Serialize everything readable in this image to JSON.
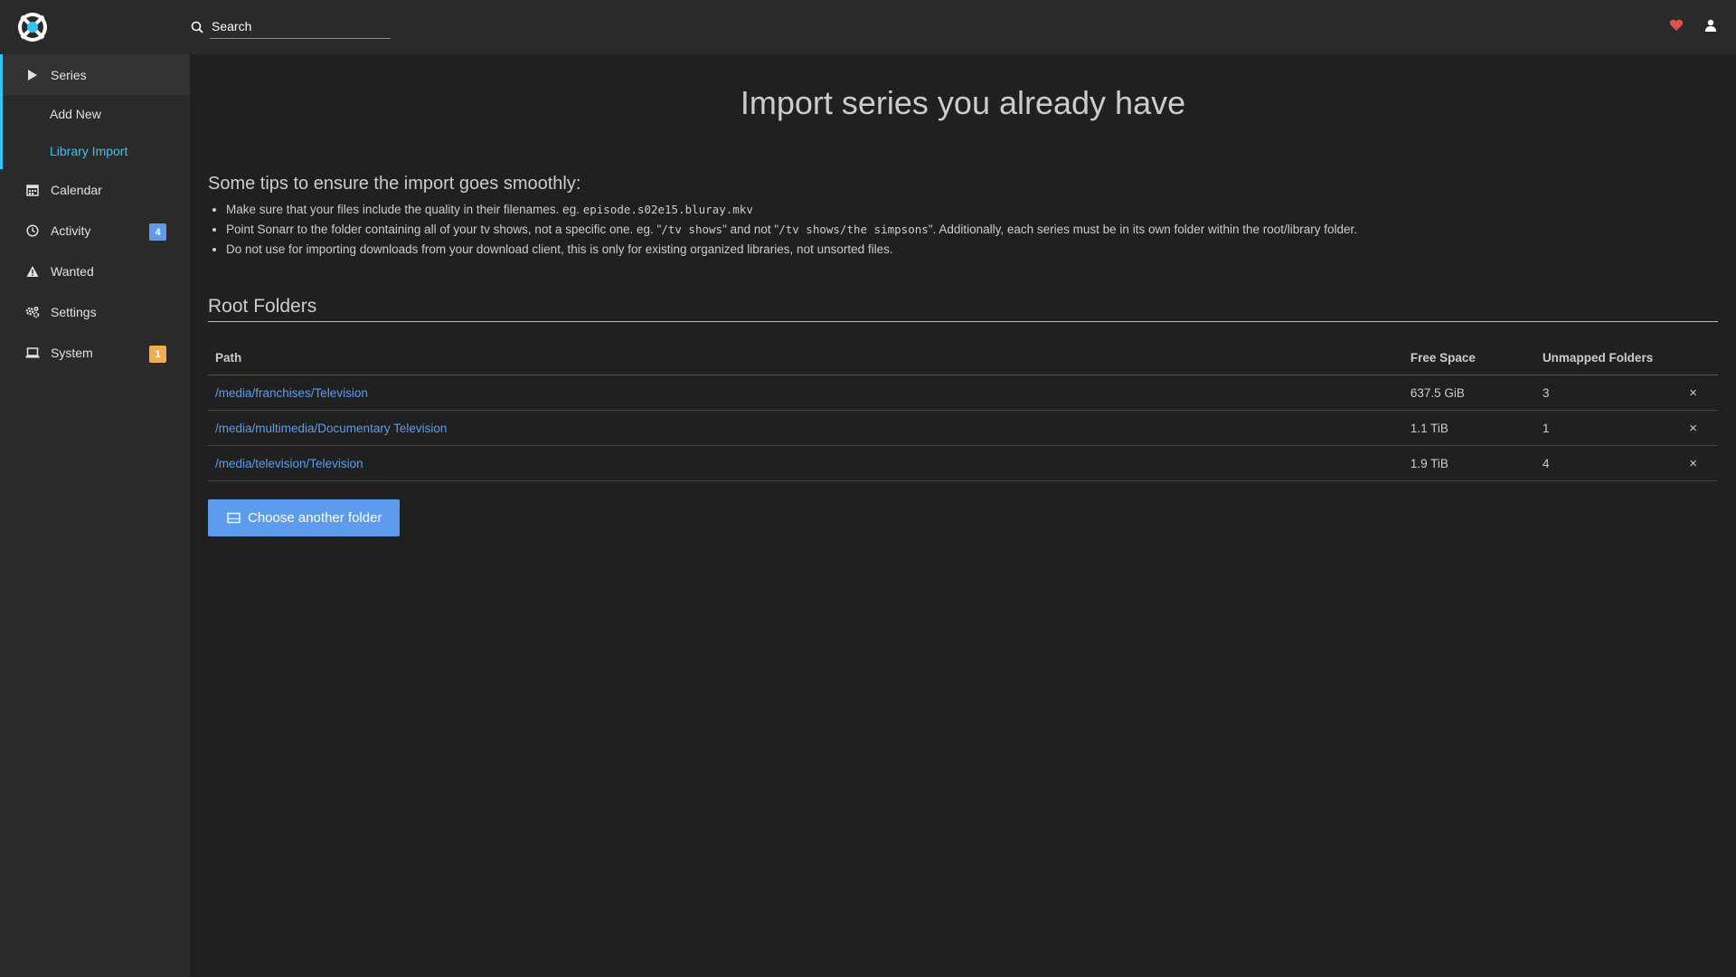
{
  "header": {
    "search_placeholder": "Search"
  },
  "sidebar": {
    "items": [
      {
        "label": "Series",
        "icon": "play-icon",
        "active": true,
        "children": [
          {
            "label": "Add New",
            "active": false
          },
          {
            "label": "Library Import",
            "active": true
          }
        ]
      },
      {
        "label": "Calendar",
        "icon": "calendar-icon"
      },
      {
        "label": "Activity",
        "icon": "clock-icon",
        "badge": "4",
        "badge_color": "#5d9cec"
      },
      {
        "label": "Wanted",
        "icon": "warning-icon"
      },
      {
        "label": "Settings",
        "icon": "cogs-icon"
      },
      {
        "label": "System",
        "icon": "laptop-icon",
        "badge": "1",
        "badge_color": "#f0ad4e"
      }
    ]
  },
  "main": {
    "title": "Import series you already have",
    "tips_title": "Some tips to ensure the import goes smoothly:",
    "tips": [
      {
        "text1": "Make sure that your files include the quality in their filenames. eg. ",
        "code1": "episode.s02e15.bluray.mkv"
      },
      {
        "text1": "Point Sonarr to the folder containing all of your tv shows, not a specific one. eg. \"",
        "code1": "/tv shows",
        "text2": "\" and not \"",
        "code2": "/tv shows/the simpsons",
        "text3": "\". Additionally, each series must be in its own folder within the root/library folder."
      },
      {
        "text1": "Do not use for importing downloads from your download client, this is only for existing organized libraries, not unsorted files."
      }
    ],
    "root_folders_title": "Root Folders",
    "table": {
      "headers": [
        "Path",
        "Free Space",
        "Unmapped Folders"
      ],
      "rows": [
        {
          "path": "/media/franchises/Television",
          "free_space": "637.5 GiB",
          "unmapped": "3"
        },
        {
          "path": "/media/multimedia/Documentary Television",
          "free_space": "1.1 TiB",
          "unmapped": "1"
        },
        {
          "path": "/media/television/Television",
          "free_space": "1.9 TiB",
          "unmapped": "4"
        }
      ],
      "remove_glyph": "×"
    },
    "choose_button_label": "Choose another folder"
  },
  "colors": {
    "accent": "#35c5f4",
    "link": "#5d9cec",
    "heart": "#d9534f"
  }
}
